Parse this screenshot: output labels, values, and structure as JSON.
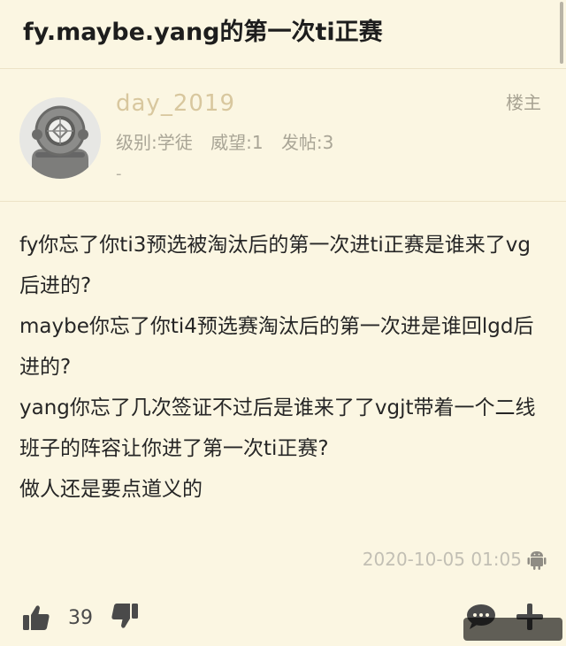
{
  "thread": {
    "title": "fy.maybe.yang的第一次ti正赛"
  },
  "post": {
    "username": "day_2019",
    "role": "楼主",
    "meta": {
      "level": "级别:学徒",
      "prestige": "威望:1",
      "posts": "发帖:3"
    },
    "signature": "-",
    "content": [
      "fy你忘了你ti3预选被淘汰后的第一次进ti正赛是谁来了vg后进的?",
      "maybe你忘了你ti4预选赛淘汰后的第一次进是谁回lgd后进的?",
      "yang你忘了几次签证不过后是谁来了了vgjt带着一个二线班子的阵容让你进了第一次ti正赛?",
      "做人还是要点道义的"
    ],
    "timestamp": "2020-10-05 01:05",
    "platform_icon": "android-icon"
  },
  "actions": {
    "like_count": "39",
    "icons": [
      "thumb-up-icon",
      "thumb-down-icon",
      "reply-bubble-icon",
      "plus-icon"
    ]
  },
  "colors": {
    "background": "#fbf6e2",
    "username": "#d8c79e",
    "muted": "#a9a596",
    "icon": "#4a4a4a"
  }
}
